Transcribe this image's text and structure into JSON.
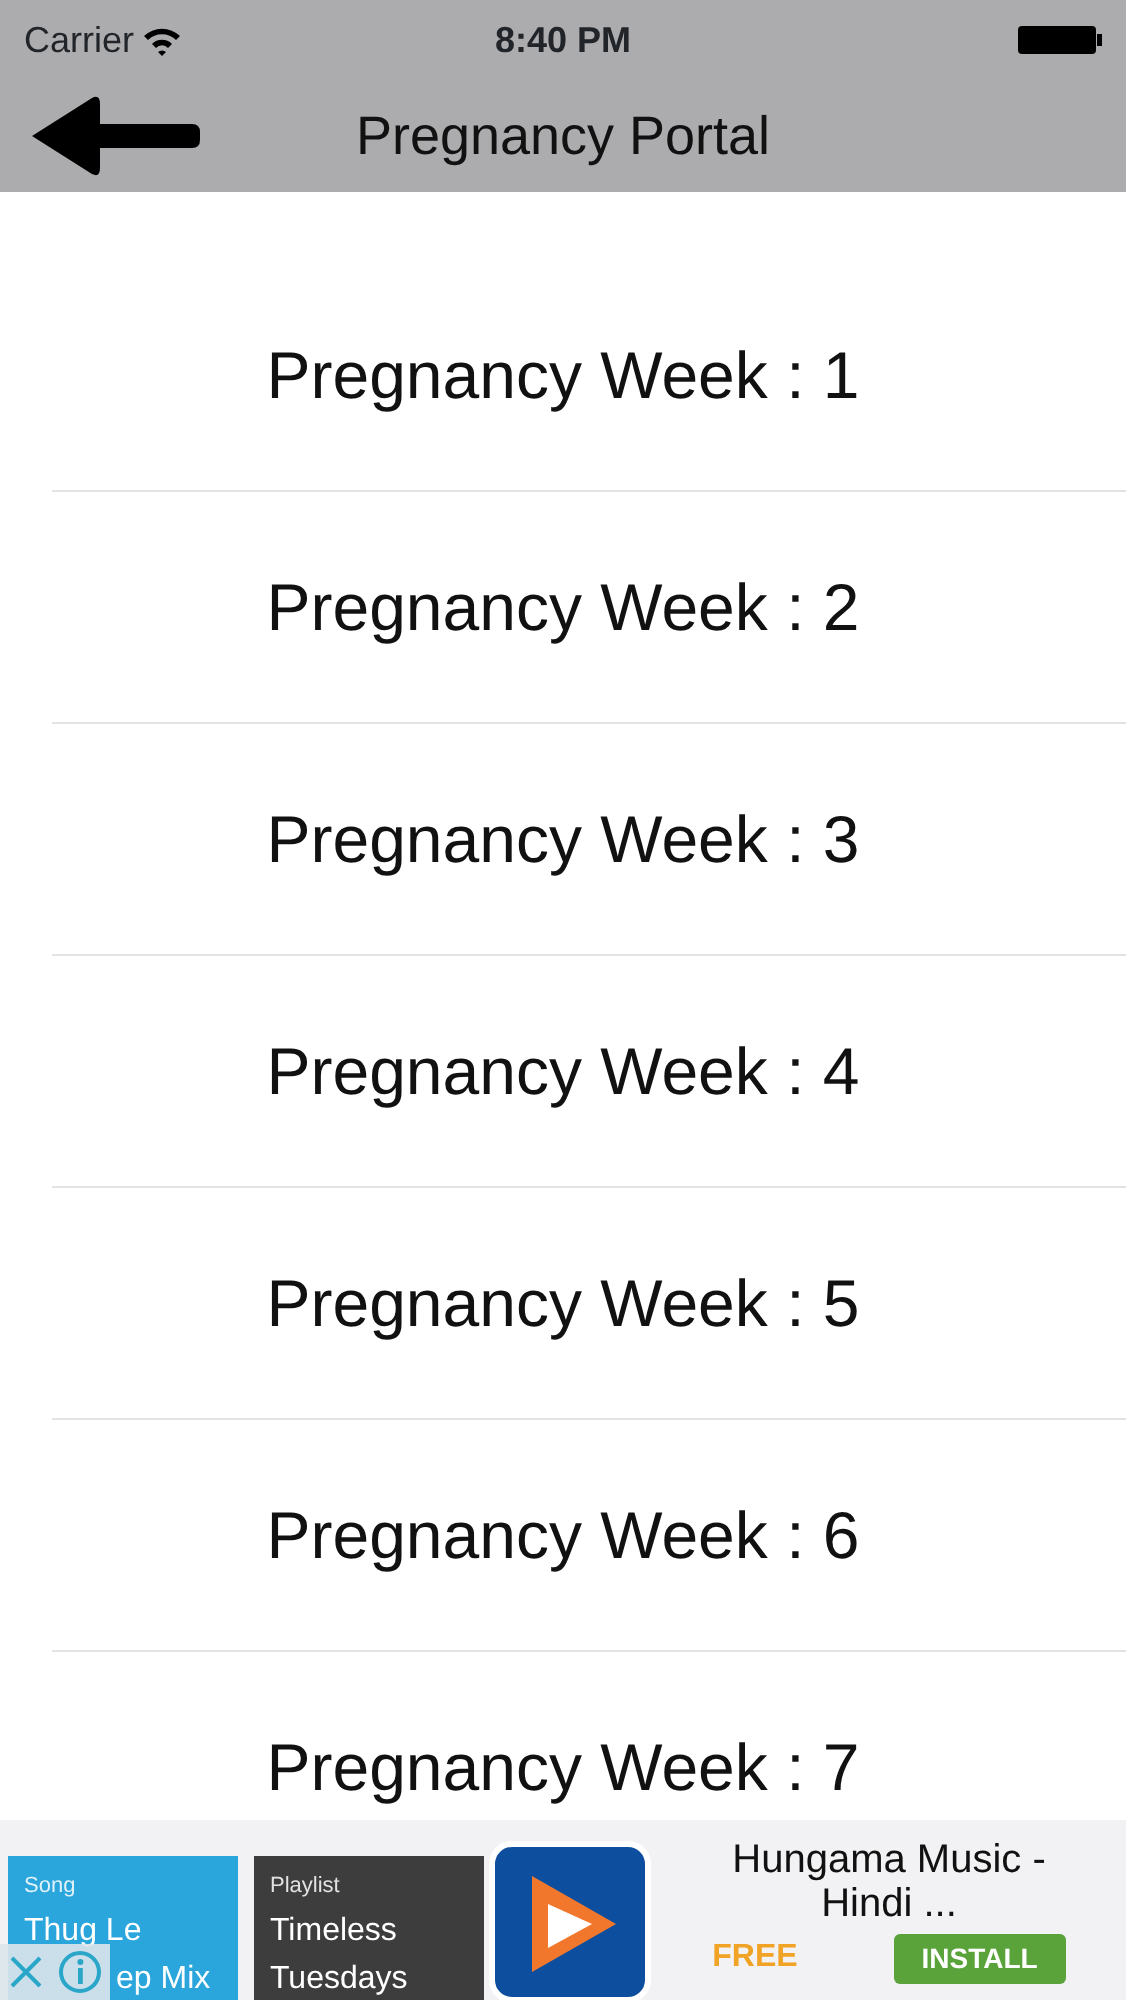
{
  "status_bar": {
    "carrier": "Carrier",
    "time": "8:40 PM"
  },
  "nav": {
    "title": "Pregnancy Portal"
  },
  "weeks": [
    {
      "label": "Pregnancy Week : 1"
    },
    {
      "label": "Pregnancy Week : 2"
    },
    {
      "label": "Pregnancy Week : 3"
    },
    {
      "label": "Pregnancy Week : 4"
    },
    {
      "label": "Pregnancy Week : 5"
    },
    {
      "label": "Pregnancy Week : 6"
    },
    {
      "label": "Pregnancy Week : 7"
    }
  ],
  "ad": {
    "tiles": [
      {
        "kind": "song",
        "tag": "Song",
        "title": "Thug Le",
        "subtitle": "ep Mix"
      },
      {
        "kind": "playlist",
        "tag": "Playlist",
        "title": "Timeless",
        "subtitle": "Tuesdays"
      }
    ],
    "app_name": "Hungama Music - Hindi ...",
    "price": "FREE",
    "install": "INSTALL"
  }
}
